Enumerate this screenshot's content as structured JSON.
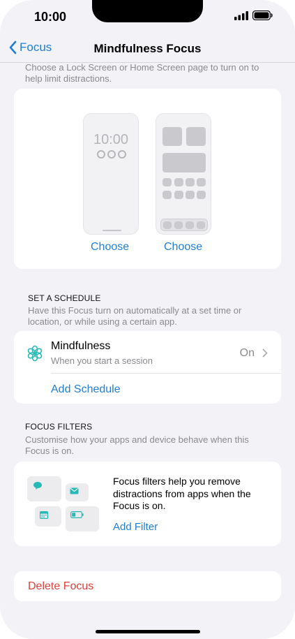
{
  "status": {
    "time": "10:00"
  },
  "nav": {
    "back_label": "Focus",
    "title": "Mindfulness Focus"
  },
  "screens": {
    "description": "Choose a Lock Screen or Home Screen page to turn on to help limit distractions.",
    "lock_preview_time": "10:00",
    "choose_lock_label": "Choose",
    "choose_home_label": "Choose"
  },
  "schedule": {
    "header": "SET A SCHEDULE",
    "description": "Have this Focus turn on automatically at a set time or location, or while using a certain app.",
    "item": {
      "title": "Mindfulness",
      "subtitle": "When you start a session",
      "value": "On"
    },
    "add_label": "Add Schedule"
  },
  "filters": {
    "header": "FOCUS FILTERS",
    "description": "Customise how your apps and device behave when this Focus is on.",
    "text": "Focus filters help you remove distractions from apps when the Focus is on.",
    "add_label": "Add Filter"
  },
  "delete_label": "Delete Focus",
  "colors": {
    "accent": "#1f7ed6",
    "destructive": "#e0413a",
    "teal": "#27b9b5"
  },
  "icons": {
    "back": "chevron-left-icon",
    "schedule": "mindfulness-flower-icon",
    "chevron": "chevron-right-icon",
    "filters": [
      "message-icon",
      "mail-icon",
      "calendar-icon",
      "battery-icon"
    ]
  }
}
